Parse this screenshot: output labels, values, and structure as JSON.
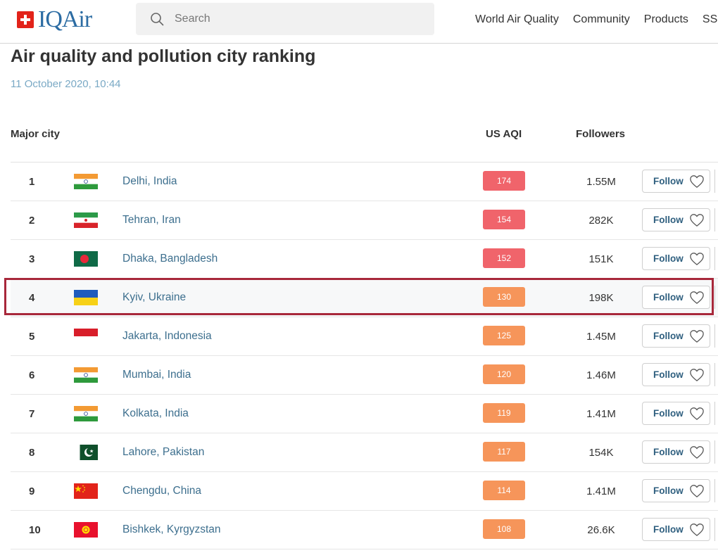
{
  "header": {
    "logo_text": "IQAir",
    "search_placeholder": "Search",
    "nav": [
      "World Air Quality",
      "Community",
      "Products",
      "SS"
    ]
  },
  "page": {
    "title": "Air quality and pollution city ranking",
    "date": "11 October 2020, 10:44"
  },
  "table": {
    "headers": {
      "city": "Major city",
      "aqi": "US AQI",
      "followers": "Followers"
    },
    "follow_label": "Follow",
    "rows": [
      {
        "rank": "1",
        "city": "Delhi, India",
        "aqi": "174",
        "followers": "1.55M",
        "flag": "india",
        "aqi_color": "#f0646b"
      },
      {
        "rank": "2",
        "city": "Tehran, Iran",
        "aqi": "154",
        "followers": "282K",
        "flag": "iran",
        "aqi_color": "#f0646b"
      },
      {
        "rank": "3",
        "city": "Dhaka, Bangladesh",
        "aqi": "152",
        "followers": "151K",
        "flag": "bangladesh",
        "aqi_color": "#f0646b"
      },
      {
        "rank": "4",
        "city": "Kyiv, Ukraine",
        "aqi": "130",
        "followers": "198K",
        "flag": "ukraine",
        "aqi_color": "#f6955a"
      },
      {
        "rank": "5",
        "city": "Jakarta, Indonesia",
        "aqi": "125",
        "followers": "1.45M",
        "flag": "indonesia",
        "aqi_color": "#f6955a"
      },
      {
        "rank": "6",
        "city": "Mumbai, India",
        "aqi": "120",
        "followers": "1.46M",
        "flag": "india",
        "aqi_color": "#f6955a"
      },
      {
        "rank": "7",
        "city": "Kolkata, India",
        "aqi": "119",
        "followers": "1.41M",
        "flag": "india",
        "aqi_color": "#f6955a"
      },
      {
        "rank": "8",
        "city": "Lahore, Pakistan",
        "aqi": "117",
        "followers": "154K",
        "flag": "pakistan",
        "aqi_color": "#f6955a"
      },
      {
        "rank": "9",
        "city": "Chengdu, China",
        "aqi": "114",
        "followers": "1.41M",
        "flag": "china",
        "aqi_color": "#f6955a"
      },
      {
        "rank": "10",
        "city": "Bishkek, Kyrgyzstan",
        "aqi": "108",
        "followers": "26.6K",
        "flag": "kyrgyzstan",
        "aqi_color": "#f6955a"
      }
    ]
  },
  "colors": {
    "brand": "#2c6ca3",
    "highlight_border": "#a8283b",
    "link": "#3d6f8e"
  }
}
